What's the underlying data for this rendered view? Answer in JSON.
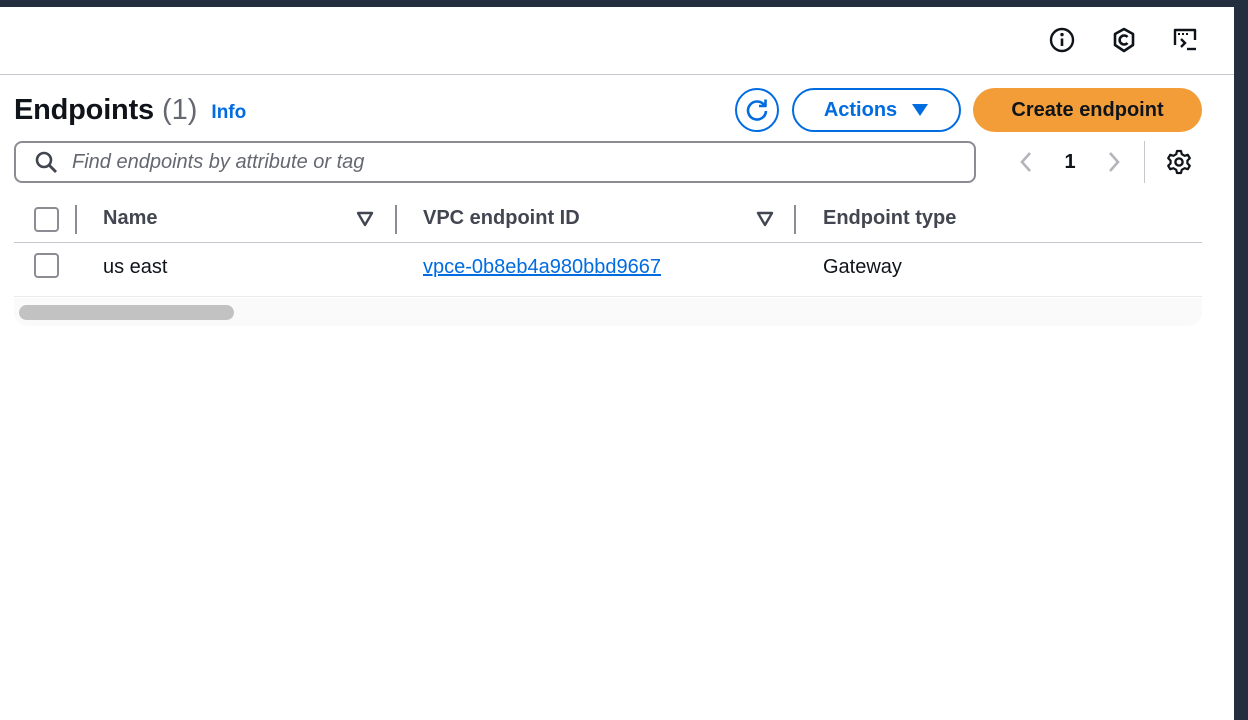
{
  "header": {
    "title": "Endpoints",
    "count": "(1)",
    "info_label": "Info"
  },
  "toolbar": {
    "actions_label": "Actions",
    "create_label": "Create endpoint"
  },
  "search": {
    "placeholder": "Find endpoints by attribute or tag"
  },
  "pagination": {
    "current_page": "1"
  },
  "table": {
    "columns": [
      "Name",
      "VPC endpoint ID",
      "Endpoint type"
    ],
    "rows": [
      {
        "name": "us east",
        "vpc_endpoint_id": "vpce-0b8eb4a980bbd9667",
        "endpoint_type": "Gateway"
      }
    ]
  },
  "colors": {
    "accent": "#006ce0",
    "primary_button": "#f29d38",
    "top_bar": "#232f3e"
  },
  "icons": [
    "info-icon",
    "shield-icon",
    "cloudshell-icon",
    "refresh-icon",
    "caret-down-icon",
    "search-icon",
    "chevron-left-icon",
    "chevron-right-icon",
    "gear-icon",
    "sort-icon"
  ]
}
